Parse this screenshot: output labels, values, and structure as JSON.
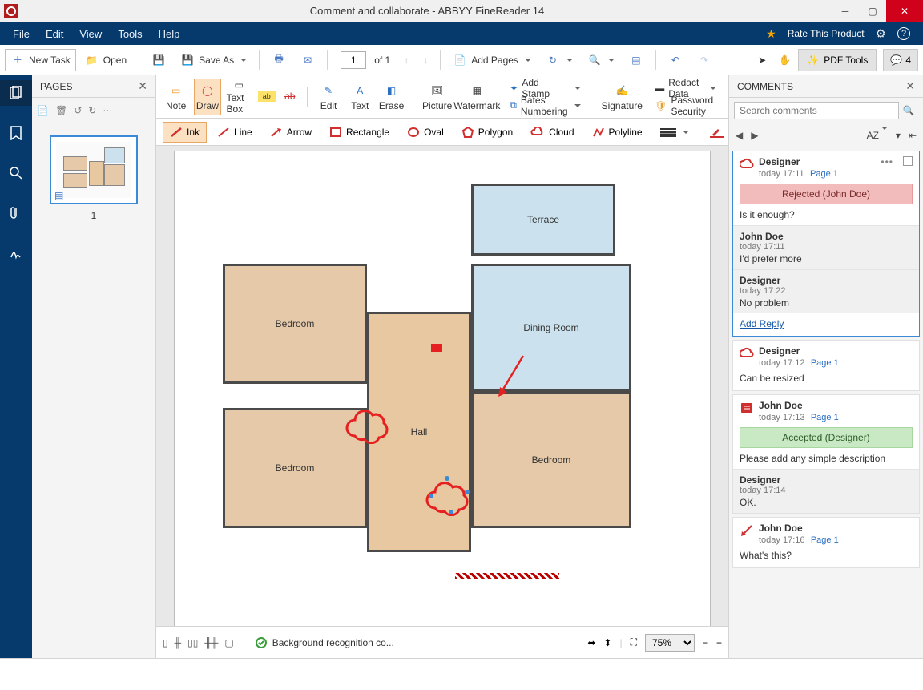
{
  "title": "Comment and collaborate - ABBYY FineReader 14",
  "menu": {
    "file": "File",
    "edit": "Edit",
    "view": "View",
    "tools": "Tools",
    "help": "Help",
    "rate": "Rate This Product"
  },
  "toolbar": {
    "newtask": "New Task",
    "open": "Open",
    "saveas": "Save As",
    "pagein": "1",
    "pageof": "of 1",
    "addpages": "Add Pages",
    "pdftools": "PDF Tools",
    "chat": "4"
  },
  "pages": {
    "title": "PAGES",
    "num": "1"
  },
  "annot": {
    "note": "Note",
    "draw": "Draw",
    "textbox": "Text Box",
    "edit": "Edit",
    "text": "Text",
    "erase": "Erase",
    "picture": "Picture",
    "watermark": "Watermark",
    "addstamp": "Add Stamp",
    "bates": "Bates Numbering",
    "signature": "Signature",
    "redact": "Redact Data",
    "pwdsec": "Password Security"
  },
  "shapes": {
    "ink": "Ink",
    "line": "Line",
    "arrow": "Arrow",
    "rect": "Rectangle",
    "oval": "Oval",
    "poly": "Polygon",
    "cloud": "Cloud",
    "polyline": "Polyline"
  },
  "floor": {
    "bedroom": "Bedroom",
    "hall": "Hall",
    "dining": "Dining Room",
    "terrace": "Terrace"
  },
  "bottom": {
    "bgrec": "Background recognition co...",
    "zoom": "75%"
  },
  "comments": {
    "title": "COMMENTS",
    "search_ph": "Search comments",
    "sort": "AZ",
    "addreply": "Add Reply",
    "threads": [
      {
        "author": "Designer",
        "time": "today 17:11",
        "page": "Page 1",
        "status": "Rejected (John Doe)",
        "text": "Is it enough?",
        "statusType": "rej",
        "replies": [
          {
            "author": "John Doe",
            "time": "today 17:11",
            "text": "I'd prefer more"
          },
          {
            "author": "Designer",
            "time": "today 17:22",
            "text": "No problem"
          }
        ],
        "icon": "cloud"
      },
      {
        "author": "Designer",
        "time": "today 17:12",
        "page": "Page 1",
        "text": "Can be resized",
        "icon": "cloud"
      },
      {
        "author": "John Doe",
        "time": "today 17:13",
        "page": "Page 1",
        "status": "Accepted (Designer)",
        "statusType": "acc",
        "text": "Please add any simple description",
        "icon": "note",
        "replies": [
          {
            "author": "Designer",
            "time": "today 17:14",
            "text": "OK."
          }
        ]
      },
      {
        "author": "John Doe",
        "time": "today 17:16",
        "page": "Page 1",
        "text": "What's this?",
        "icon": "arrow"
      }
    ]
  }
}
